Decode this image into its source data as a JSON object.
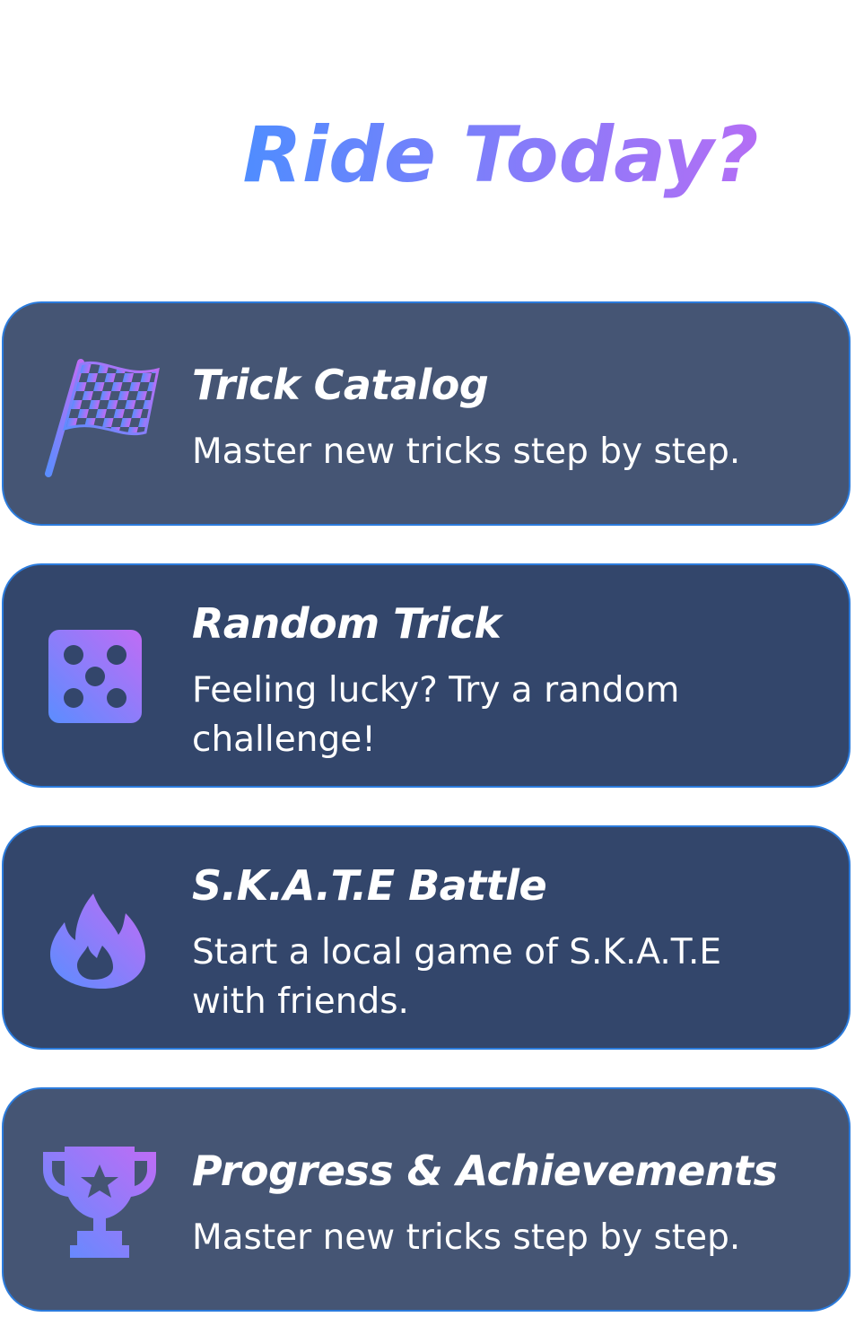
{
  "header": {
    "title": "Ride Today?",
    "gradient": [
      "#4f8dff",
      "#b46ef5"
    ]
  },
  "menu": {
    "items": [
      {
        "id": "trick-catalog",
        "title": "Trick Catalog",
        "description": "Master new tricks step by step.",
        "icon": "checkered-flag-icon",
        "tone": "light"
      },
      {
        "id": "random-trick",
        "title": "Random Trick",
        "description": "Feeling lucky? Try a random challenge!",
        "icon": "dice-icon",
        "tone": "dark"
      },
      {
        "id": "skate-battle",
        "title": "S.K.A.T.E Battle",
        "description": "Start a local game of S.K.A.T.E with friends.",
        "icon": "fire-icon",
        "tone": "dark"
      },
      {
        "id": "progress",
        "title": "Progress & Achievements",
        "description": "Master new tricks step by step.",
        "icon": "trophy-icon",
        "tone": "light"
      }
    ]
  },
  "colors": {
    "card_light": "#455574",
    "card_dark": "#33466b",
    "card_border": "#2b7bdc",
    "icon_gradient_start": "#5b8dff",
    "icon_gradient_end": "#c06cf5"
  }
}
